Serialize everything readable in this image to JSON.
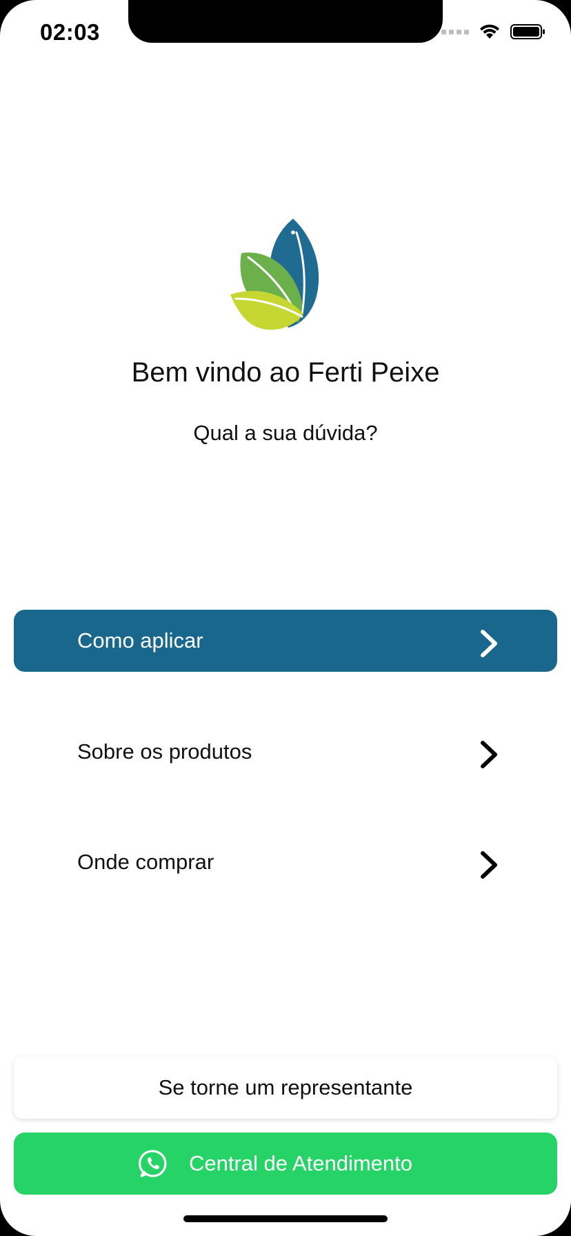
{
  "status_bar": {
    "time": "02:03"
  },
  "header": {
    "logo": "ferti-peixe-leaf-logo",
    "title": "Bem vindo ao Ferti Peixe",
    "subtitle": "Qual a sua dúvida?"
  },
  "menu": {
    "items": [
      {
        "label": "Como aplicar",
        "active": true
      },
      {
        "label": "Sobre os produtos",
        "active": false
      },
      {
        "label": "Onde comprar",
        "active": false
      }
    ]
  },
  "footer": {
    "representative_label": "Se torne um representante",
    "support_label": "Central de Atendimento",
    "support_icon": "whatsapp-icon"
  },
  "colors": {
    "primary": "#19678d",
    "whatsapp": "#26d366",
    "leaf_blue": "#1f6b92",
    "leaf_green": "#6bb04a",
    "leaf_yellow": "#c6d632"
  }
}
